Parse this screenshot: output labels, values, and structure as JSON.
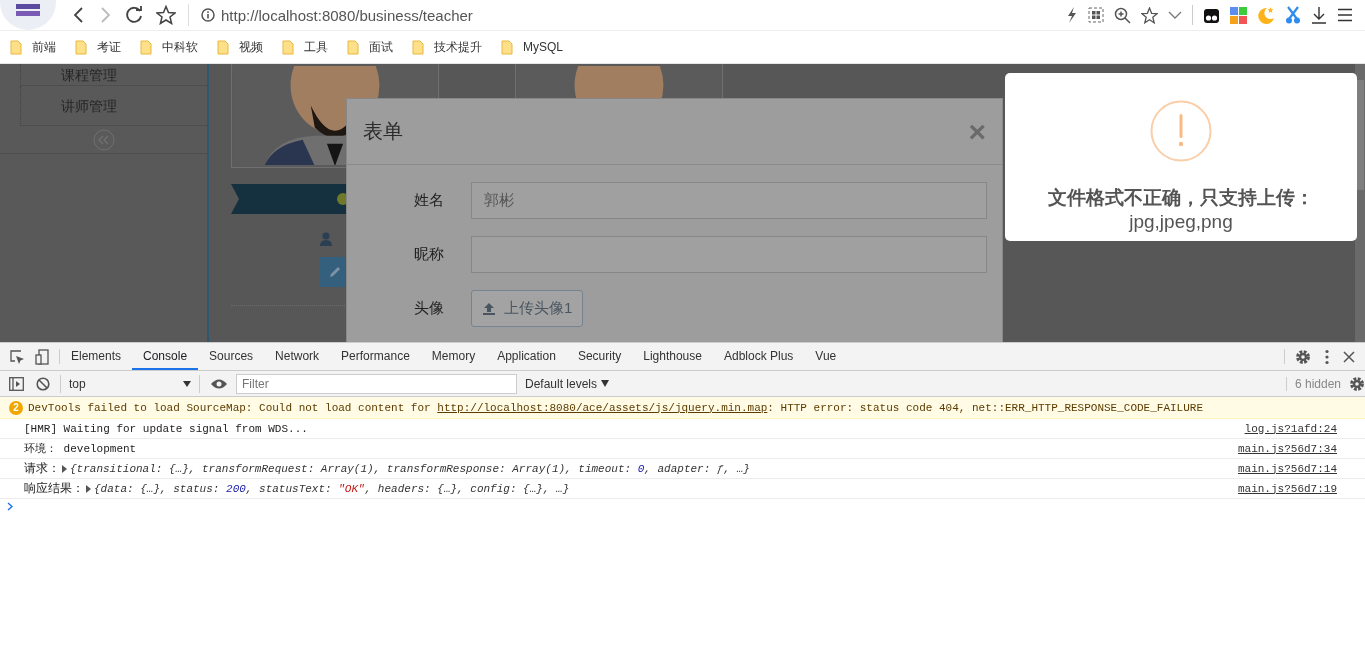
{
  "browser": {
    "url": "http://localhost:8080/business/teacher",
    "bookmarks": [
      "前端",
      "考证",
      "中科软",
      "视频",
      "工具",
      "面试",
      "技术提升",
      "MySQL"
    ]
  },
  "sidebar": {
    "items": [
      {
        "label": "课程管理"
      },
      {
        "label": "讲师管理"
      }
    ]
  },
  "modal": {
    "title": "表单",
    "close": "×",
    "fields": [
      {
        "kind": "text",
        "label": "姓名",
        "value": "郭彬"
      },
      {
        "kind": "text",
        "label": "昵称"
      },
      {
        "kind": "upload",
        "label": "头像",
        "button": "上传头像1"
      }
    ]
  },
  "alert": {
    "title": "文件格式不正确，只支持上传：",
    "detail": "jpg,jpeg,png"
  },
  "devtools": {
    "tabs": [
      {
        "label": "Elements",
        "selected": false
      },
      {
        "label": "Console",
        "selected": true
      },
      {
        "label": "Sources",
        "selected": false
      },
      {
        "label": "Network",
        "selected": false
      },
      {
        "label": "Performance",
        "selected": false
      },
      {
        "label": "Memory",
        "selected": false
      },
      {
        "label": "Application",
        "selected": false
      },
      {
        "label": "Security",
        "selected": false
      },
      {
        "label": "Lighthouse",
        "selected": false
      },
      {
        "label": "Adblock Plus",
        "selected": false
      },
      {
        "label": "Vue",
        "selected": false
      }
    ],
    "context": "top",
    "filter_placeholder": "Filter",
    "levels": "Default levels",
    "hidden": "6 hidden",
    "messages": [
      {
        "kind": "warning",
        "count": "2",
        "text": "DevTools failed to load SourceMap: Could not load content for ",
        "link": "http://localhost:8080/ace/assets/js/jquery.min.map",
        "text_after": ": HTTP error: status code 404, net::ERR_HTTP_RESPONSE_CODE_FAILURE"
      },
      {
        "kind": "log",
        "text": "[HMR] Waiting for update signal from WDS...",
        "source": "log.js?1afd:24"
      },
      {
        "kind": "log",
        "text": "环境： development",
        "source": "main.js?56d7:34"
      },
      {
        "kind": "object",
        "label": "请求：",
        "parts": [
          {
            "kind": "plain",
            "text": "{transitional: {…}, transformRequest: Array(1), transformResponse: Array(1), timeout: "
          },
          {
            "kind": "number",
            "text": "0"
          },
          {
            "kind": "plain",
            "text": ", adapter: ƒ, …}"
          }
        ],
        "source": "main.js?56d7:14"
      },
      {
        "kind": "object",
        "label": "响应结果：",
        "parts": [
          {
            "kind": "plain",
            "text": "{data: {…}, status: "
          },
          {
            "kind": "number",
            "text": "200"
          },
          {
            "kind": "plain",
            "text": ", statusText: "
          },
          {
            "kind": "string",
            "text": "\"OK\""
          },
          {
            "kind": "plain",
            "text": ", headers: {…}, config: {…}, …}"
          }
        ],
        "source": "main.js?56d7:19"
      }
    ]
  }
}
